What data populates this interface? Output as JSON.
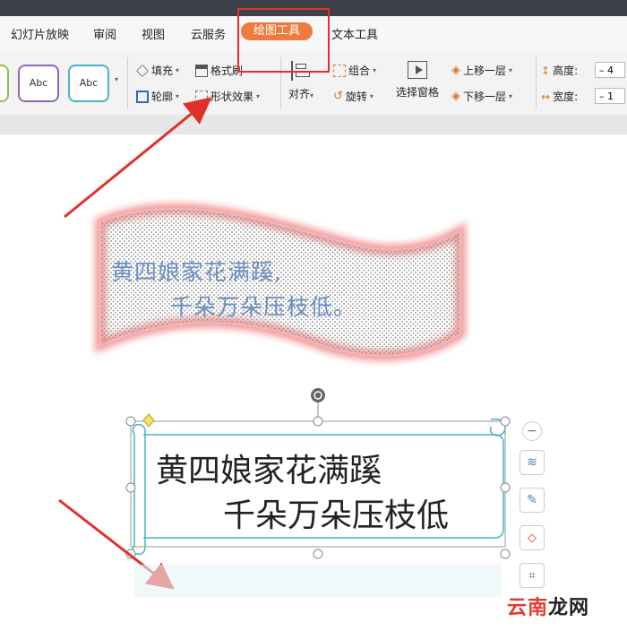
{
  "tabs": [
    {
      "label": "幻灯片放映",
      "active": false
    },
    {
      "label": "审阅",
      "active": false
    },
    {
      "label": "视图",
      "active": false
    },
    {
      "label": "云服务",
      "active": false
    },
    {
      "label": "绘图工具",
      "active": true
    },
    {
      "label": "文本工具",
      "active": false
    }
  ],
  "ribbon": {
    "style_samples": [
      "Abc",
      "Abc"
    ],
    "fill": "填充",
    "format_painter": "格式刷",
    "outline": "轮廓",
    "shape_effects": "形状效果",
    "align": "对齐",
    "group": "组合",
    "rotate": "旋转",
    "selection_pane": "选择窗格",
    "bring_forward": "上移一层",
    "send_backward": "下移一层",
    "height_label": "高度:",
    "height_value": "4",
    "width_label": "宽度:",
    "width_value": "1",
    "minus": "–"
  },
  "canvas": {
    "banner_line1": "黄四娘家花满蹊,",
    "banner_line2": "千朵万朵压枝低。",
    "scroll_line1": "黄四娘家花满蹊",
    "scroll_line2": "千朵万朵压枝低"
  },
  "watermark": {
    "part1": "云南",
    "part2": "龙网"
  },
  "colors": {
    "accent_tab": "#ee7b3d",
    "highlight_red": "#e0302a",
    "banner_text": "#6a8fc1"
  }
}
